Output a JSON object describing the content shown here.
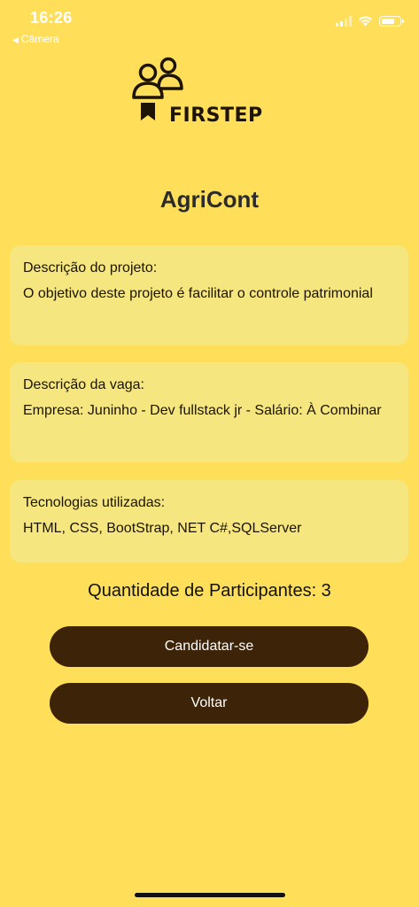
{
  "status_bar": {
    "time": "16:26",
    "back_app": "Câmera",
    "back_arrow": "◀"
  },
  "logo": {
    "text": "FIRSTEP",
    "icon": "people-bookmark-icon"
  },
  "project": {
    "title": "AgriCont"
  },
  "cards": {
    "project_description": {
      "label": "Descrição do projeto:",
      "text": "O objetivo deste projeto é facilitar o controle patrimonial"
    },
    "job_description": {
      "label": "Descrição da vaga:",
      "text": "Empresa: Juninho - Dev fullstack jr -  Salário: À Combinar"
    },
    "technologies": {
      "label": "Tecnologias utilizadas:",
      "text": "HTML, CSS, BootStrap, NET C#,SQLServer"
    }
  },
  "participants": {
    "text": "Quantidade de Participantes: 3"
  },
  "buttons": {
    "apply": "Candidatar-se",
    "back": "Voltar"
  },
  "colors": {
    "background": "#FFDE59",
    "card": "#F5E67F",
    "button": "#3D2409",
    "button_text": "#FFFFFF"
  }
}
